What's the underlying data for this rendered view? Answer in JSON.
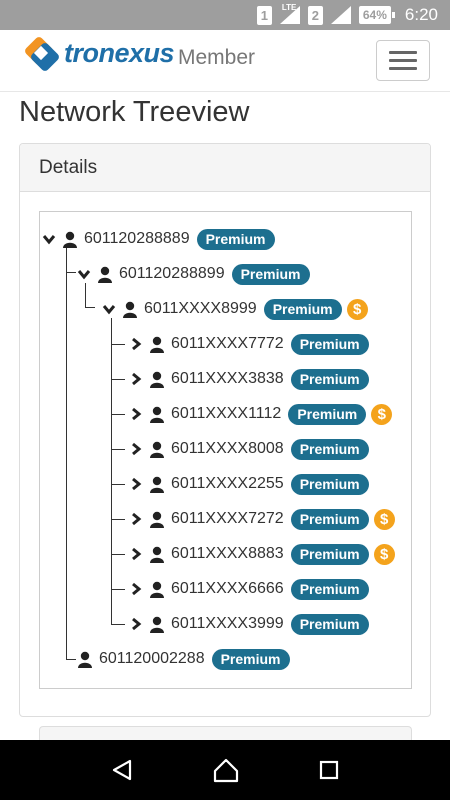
{
  "status_bar": {
    "sim1": "1",
    "sim2": "2",
    "network": "LTE",
    "battery": "64%",
    "time": "6:20"
  },
  "header": {
    "logo_text": "tronexus",
    "brand_sub": "Member"
  },
  "page": {
    "title": "Network Treeview",
    "panel_heading": "Details"
  },
  "tree": {
    "badge": "Premium",
    "dollar": "$",
    "root": "601120288889",
    "level1": [
      "601120288899",
      "601120002288"
    ],
    "level2": "6011XXXX8999",
    "level3": [
      {
        "id": "6011XXXX7772",
        "dollar": false
      },
      {
        "id": "6011XXXX3838",
        "dollar": false
      },
      {
        "id": "6011XXXX1112",
        "dollar": true
      },
      {
        "id": "6011XXXX8008",
        "dollar": false
      },
      {
        "id": "6011XXXX2255",
        "dollar": false
      },
      {
        "id": "6011XXXX7272",
        "dollar": true
      },
      {
        "id": "6011XXXX8883",
        "dollar": true
      },
      {
        "id": "6011XXXX6666",
        "dollar": false
      },
      {
        "id": "6011XXXX3999",
        "dollar": false
      }
    ]
  },
  "colors": {
    "badge": "#1d6f8f",
    "dollar": "#f4a31c",
    "status_bar": "#9e9e9e"
  }
}
